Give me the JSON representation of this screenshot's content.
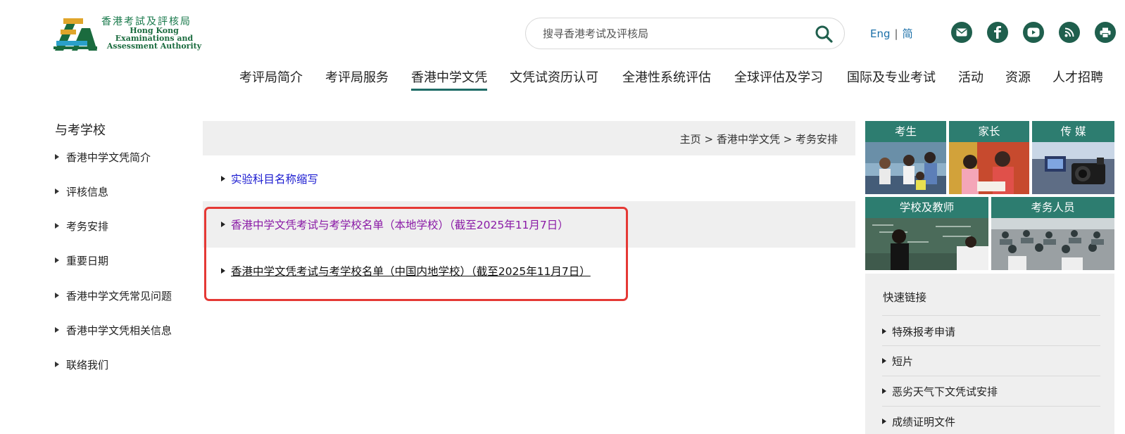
{
  "header": {
    "logo": {
      "chinese": "香港考試及評核局",
      "english_lines": [
        "Hong Kong",
        "Examinations and",
        "Assessment Authority"
      ]
    },
    "search": {
      "placeholder": "搜寻香港考试及评核局"
    },
    "lang": {
      "eng": "Eng",
      "separator": "|",
      "simplified": "简"
    },
    "social_icons": [
      "email-icon",
      "facebook-icon",
      "youtube-icon",
      "rss-icon",
      "print-icon"
    ]
  },
  "nav": {
    "items": [
      "考评局简介",
      "考评局服务",
      "香港中学文凭",
      "文凭试资历认可",
      "全港性系统评估",
      "全球评估及学习",
      "国际及专业考试",
      "活动",
      "资源",
      "人才招聘"
    ],
    "active": "香港中学文凭"
  },
  "sidebar": {
    "title": "与考学校",
    "items": [
      "香港中学文凭简介",
      "评核信息",
      "考务安排",
      "重要日期",
      "香港中学文凭常见问题",
      "香港中学文凭相关信息",
      "联络我们"
    ]
  },
  "breadcrumb": {
    "home": "主页",
    "section": "香港中学文凭",
    "current": "考务安排",
    "separator": ">"
  },
  "content": {
    "links": [
      "实验科目名称缩写",
      "香港中学文凭考试与考学校名单（本地学校）（截至2025年11月7日）",
      "香港中学文凭考试与考学校名单（中国内地学校）（截至2025年11月7日）"
    ]
  },
  "right_panel": {
    "tiles": [
      "考生",
      "家长",
      "传 媒",
      "学校及教师",
      "考务人员"
    ],
    "quick_links": {
      "title": "快速链接",
      "items": [
        "特殊报考申请",
        "短片",
        "恶劣天气下文凭试安排",
        "成绩证明文件"
      ]
    }
  },
  "colors": {
    "brand_green": "#2d7d70",
    "social_dark": "#1f5f4d",
    "highlight_red": "#e53935",
    "link_blue": "#1a1ad0",
    "link_purple": "#8a1aa6"
  }
}
